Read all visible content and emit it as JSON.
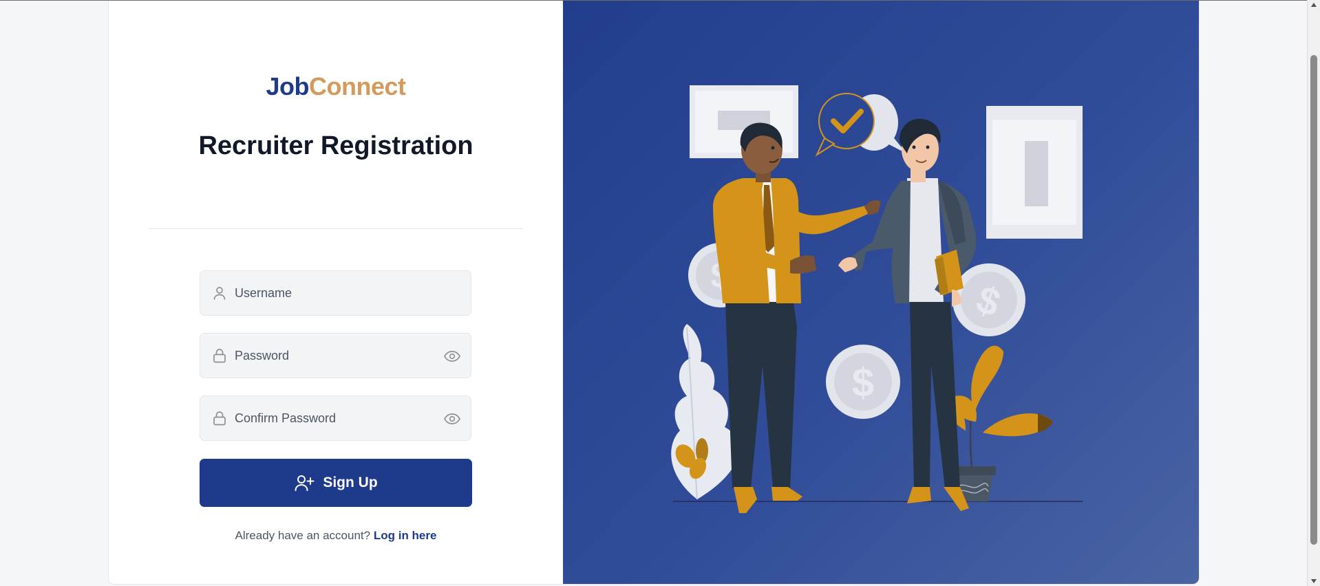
{
  "brand": {
    "part1": "Job",
    "part2": "Connect"
  },
  "page": {
    "title": "Recruiter Registration"
  },
  "form": {
    "username": {
      "placeholder": "Username",
      "value": ""
    },
    "password": {
      "placeholder": "Password",
      "value": ""
    },
    "confirm_password": {
      "placeholder": "Confirm Password",
      "value": ""
    },
    "submit_label": "Sign Up"
  },
  "footer": {
    "prompt": "Already have an account?",
    "link_label": "Log in here"
  },
  "colors": {
    "primary": "#1e3a8a",
    "accent": "#d39a5c",
    "illustration_bg": "#2c4894",
    "mustard": "#d4941a"
  },
  "icons": {
    "username": "user-icon",
    "password": "lock-icon",
    "confirm_password": "lock-icon",
    "toggle": "eye-icon",
    "submit": "user-plus-icon"
  }
}
